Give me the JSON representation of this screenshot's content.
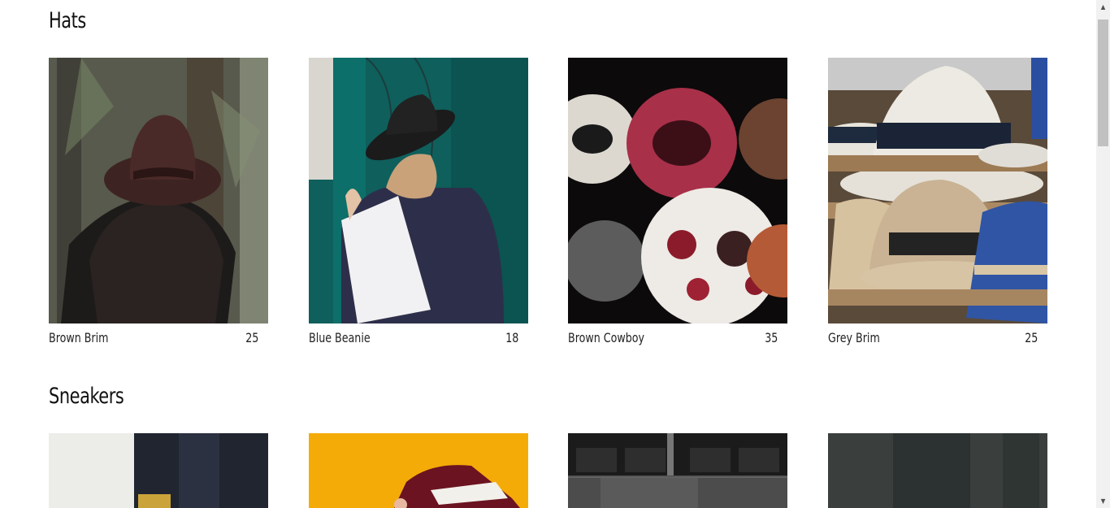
{
  "sections": [
    {
      "title": "Hats",
      "items": [
        {
          "name": "Brown Brim",
          "price": "25"
        },
        {
          "name": "Blue Beanie",
          "price": "18"
        },
        {
          "name": "Brown Cowboy",
          "price": "35"
        },
        {
          "name": "Grey Brim",
          "price": "25"
        }
      ]
    },
    {
      "title": "Sneakers",
      "items": []
    }
  ],
  "scrollbar": {
    "up_glyph": "▲",
    "down_glyph": "▼"
  }
}
